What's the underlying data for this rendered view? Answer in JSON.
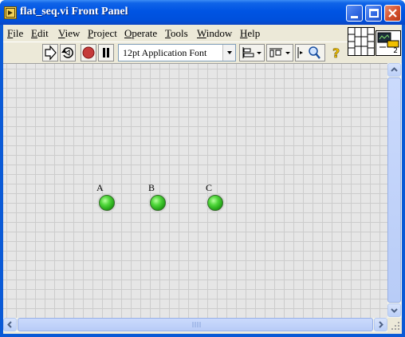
{
  "window": {
    "title": "flat_seq.vi Front Panel",
    "controls": {
      "minimize": "_",
      "maximize": "□",
      "close": "✕"
    }
  },
  "menu": {
    "items": [
      {
        "first": "F",
        "rest": "ile"
      },
      {
        "first": "E",
        "rest": "dit"
      },
      {
        "first": "V",
        "rest": "iew"
      },
      {
        "first": "P",
        "rest": "roject"
      },
      {
        "first": "O",
        "rest": "perate"
      },
      {
        "first": "T",
        "rest": "ools"
      },
      {
        "first": "W",
        "rest": "indow"
      },
      {
        "first": "H",
        "rest": "elp"
      }
    ]
  },
  "toolbar": {
    "font_select": "12pt Application Font",
    "icons": [
      "run-arrow-icon",
      "run-continuously-icon",
      "abort-icon",
      "pause-icon",
      "align-objects-icon",
      "distribute-objects-icon",
      "resize-objects-icon",
      "zoom-icon",
      "help-icon"
    ]
  },
  "connector_pane": {
    "terminal_count": "2"
  },
  "panel": {
    "indicators": [
      {
        "label": "A",
        "state": "on",
        "color": "#3fcf2c"
      },
      {
        "label": "B",
        "state": "on",
        "color": "#3fcf2c"
      },
      {
        "label": "C",
        "state": "on",
        "color": "#3fcf2c"
      }
    ],
    "grid_visible": true
  },
  "colors": {
    "titlebar": "#0054e3",
    "client_bg": "#ece9d8",
    "panel_bg": "#e6e6e6",
    "grid": "#cccccc",
    "led_on": "#3fcf2c"
  }
}
